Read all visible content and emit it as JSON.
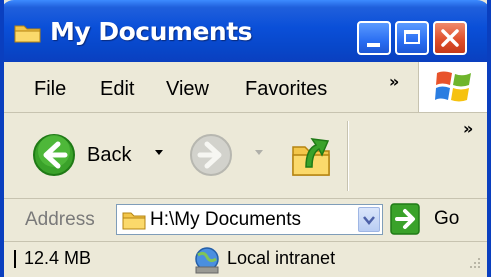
{
  "window": {
    "title": "My Documents",
    "title_icon": "folder-icon",
    "controls": [
      "minimize-icon",
      "maximize-icon",
      "close-icon"
    ],
    "accent": "#0a4fd8"
  },
  "menubar": {
    "items": [
      {
        "label": "File"
      },
      {
        "label": "Edit"
      },
      {
        "label": "View"
      },
      {
        "label": "Favorites"
      }
    ],
    "overflow": "»",
    "logo": "windows-logo-icon"
  },
  "toolbar": {
    "back_label": "Back",
    "back_icon": "back-arrow-icon",
    "forward_icon": "forward-arrow-icon",
    "up_icon": "folder-up-icon",
    "overflow": "»"
  },
  "addressbar": {
    "label": "Address",
    "value": "H:\\My Documents",
    "go_label": "Go"
  },
  "statusbar": {
    "size": "12.4 MB",
    "zone": "Local intranet",
    "zone_icon": "local-intranet-icon"
  }
}
